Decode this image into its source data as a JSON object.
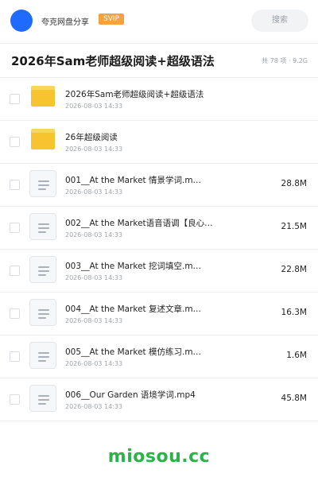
{
  "header": {
    "share_name": "夸克网盘分享",
    "badge": "SVIP",
    "search_label": "搜索"
  },
  "folder": {
    "title": "2026年Sam老师超级阅读+超级语法",
    "meta": "共 78 项 · 9.2G"
  },
  "items": [
    {
      "type": "folder",
      "name": "2026年Sam老师超级阅读+超级语法",
      "date": "2026-08-03 14:33",
      "size": ""
    },
    {
      "type": "folder",
      "name": "26年超级阅读",
      "date": "2026-08-03 14:33",
      "size": ""
    },
    {
      "type": "file",
      "name": "001__At the Market 情景学词.m…",
      "date": "2026-08-03 14:33",
      "size": "28.8M"
    },
    {
      "type": "file",
      "name": "002__At the Market语音语调【良心…",
      "date": "2026-08-03 14:33",
      "size": "21.5M"
    },
    {
      "type": "file",
      "name": "003__At the Market 挖词填空.m…",
      "date": "2026-08-03 14:33",
      "size": "22.8M"
    },
    {
      "type": "file",
      "name": "004__At the Market 复述文章.m…",
      "date": "2026-08-03 14:33",
      "size": "16.3M"
    },
    {
      "type": "file",
      "name": "005__At the Market 模仿练习.m…",
      "date": "2026-08-03 14:33",
      "size": "1.6M"
    },
    {
      "type": "file",
      "name": "006__Our Garden 语境学词.mp4",
      "date": "2026-08-03 14:33",
      "size": "45.8M"
    }
  ],
  "watermark": "miosou.cc",
  "colors": {
    "avatar": "#1f6bff",
    "badge": "#f7a23c",
    "folder": "#f7c42f",
    "watermark": "#2bb34a"
  }
}
